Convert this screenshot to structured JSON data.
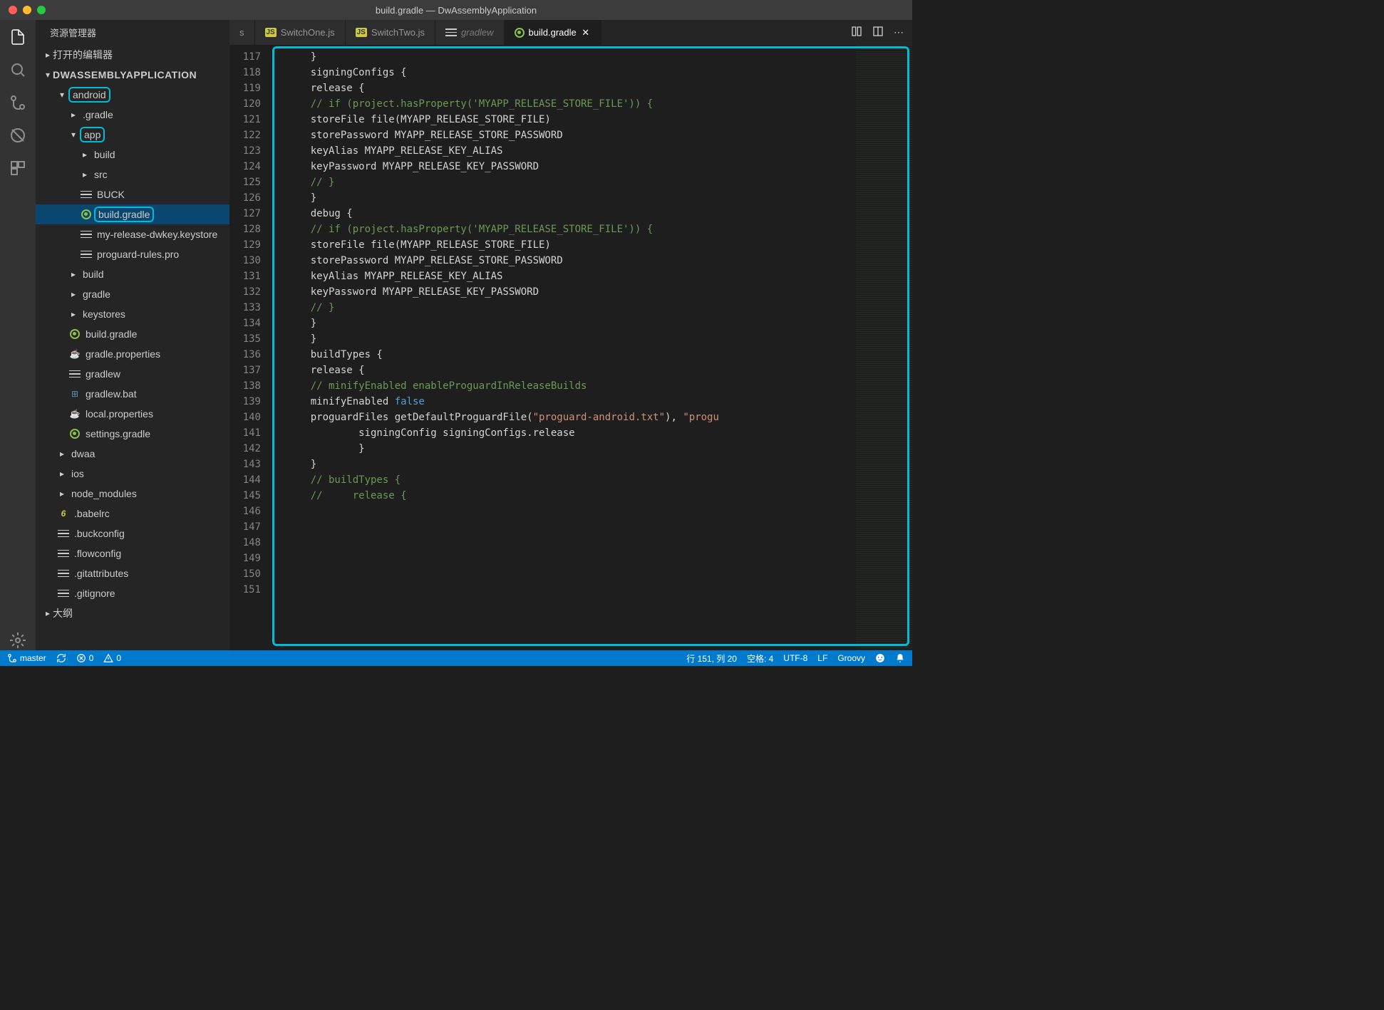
{
  "window": {
    "title": "build.gradle — DwAssemblyApplication"
  },
  "sidebar": {
    "title": "资源管理器",
    "sections": {
      "openEditors": "打开的编辑器",
      "project": "DWASSEMBLYAPPLICATION",
      "outline": "大纲"
    },
    "tree": [
      {
        "l": "android",
        "d": 1,
        "exp": true,
        "box": true
      },
      {
        "l": ".gradle",
        "d": 2,
        "kind": "folder"
      },
      {
        "l": "app",
        "d": 2,
        "exp": true,
        "box": true
      },
      {
        "l": "build",
        "d": 3,
        "kind": "folder"
      },
      {
        "l": "src",
        "d": 3,
        "kind": "folder"
      },
      {
        "l": "BUCK",
        "d": 3,
        "icon": "lines"
      },
      {
        "l": "build.gradle",
        "d": 3,
        "icon": "gradle",
        "sel": true,
        "box": true
      },
      {
        "l": "my-release-dwkey.keystore",
        "d": 3,
        "icon": "lines"
      },
      {
        "l": "proguard-rules.pro",
        "d": 3,
        "icon": "lines"
      },
      {
        "l": "build",
        "d": 2,
        "kind": "folder"
      },
      {
        "l": "gradle",
        "d": 2,
        "kind": "folder"
      },
      {
        "l": "keystores",
        "d": 2,
        "kind": "folder"
      },
      {
        "l": "build.gradle",
        "d": 2,
        "icon": "gradle"
      },
      {
        "l": "gradle.properties",
        "d": 2,
        "icon": "java"
      },
      {
        "l": "gradlew",
        "d": 2,
        "icon": "lines"
      },
      {
        "l": "gradlew.bat",
        "d": 2,
        "icon": "win"
      },
      {
        "l": "local.properties",
        "d": 2,
        "icon": "java"
      },
      {
        "l": "settings.gradle",
        "d": 2,
        "icon": "gradle"
      },
      {
        "l": "dwaa",
        "d": 1,
        "kind": "folder"
      },
      {
        "l": "ios",
        "d": 1,
        "kind": "folder"
      },
      {
        "l": "node_modules",
        "d": 1,
        "kind": "folder"
      },
      {
        "l": ".babelrc",
        "d": 1,
        "icon": "babel"
      },
      {
        "l": ".buckconfig",
        "d": 1,
        "icon": "lines"
      },
      {
        "l": ".flowconfig",
        "d": 1,
        "icon": "lines"
      },
      {
        "l": ".gitattributes",
        "d": 1,
        "icon": "lines"
      },
      {
        "l": ".gitignore",
        "d": 1,
        "icon": "lines"
      }
    ]
  },
  "tabs": [
    {
      "label": "s",
      "kind": "truncated"
    },
    {
      "label": "SwitchOne.js",
      "kind": "js"
    },
    {
      "label": "SwitchTwo.js",
      "kind": "js"
    },
    {
      "label": "gradlew",
      "kind": "italic"
    },
    {
      "label": "build.gradle",
      "kind": "gradle",
      "active": true
    }
  ],
  "code": {
    "start": 117,
    "lines": [
      {
        "t": "    }",
        "c": "id"
      },
      {
        "t": "    signingConfigs {",
        "c": "id"
      },
      {
        "t": "",
        "c": "id"
      },
      {
        "t": "    release {",
        "c": "id"
      },
      {
        "t": "    // if (project.hasProperty('MYAPP_RELEASE_STORE_FILE')) {",
        "c": "cm"
      },
      {
        "t": "    storeFile file(MYAPP_RELEASE_STORE_FILE)",
        "c": "id"
      },
      {
        "t": "    storePassword MYAPP_RELEASE_STORE_PASSWORD",
        "c": "id"
      },
      {
        "t": "    keyAlias MYAPP_RELEASE_KEY_ALIAS",
        "c": "id"
      },
      {
        "t": "    keyPassword MYAPP_RELEASE_KEY_PASSWORD",
        "c": "id"
      },
      {
        "t": "    // }",
        "c": "cm"
      },
      {
        "t": "    }",
        "c": "id"
      },
      {
        "t": "    debug {",
        "c": "id"
      },
      {
        "t": "    // if (project.hasProperty('MYAPP_RELEASE_STORE_FILE')) {",
        "c": "cm"
      },
      {
        "t": "    storeFile file(MYAPP_RELEASE_STORE_FILE)",
        "c": "id"
      },
      {
        "t": "    storePassword MYAPP_RELEASE_STORE_PASSWORD",
        "c": "id"
      },
      {
        "t": "    keyAlias MYAPP_RELEASE_KEY_ALIAS",
        "c": "id"
      },
      {
        "t": "    keyPassword MYAPP_RELEASE_KEY_PASSWORD",
        "c": "id"
      },
      {
        "t": "    // }",
        "c": "cm"
      },
      {
        "t": "    }",
        "c": "id"
      },
      {
        "t": "",
        "c": "id"
      },
      {
        "t": "",
        "c": "id"
      },
      {
        "t": "",
        "c": "id"
      },
      {
        "t": "",
        "c": "id"
      },
      {
        "t": "    }",
        "c": "id"
      },
      {
        "t": "",
        "c": "id"
      },
      {
        "t": "    buildTypes {",
        "c": "id"
      },
      {
        "t": "    release {",
        "c": "id"
      },
      {
        "t": "    // minifyEnabled enableProguardInReleaseBuilds",
        "c": "cm"
      },
      {
        "html": "    minifyEnabled <span class='kw'>false</span>"
      },
      {
        "html": "    proguardFiles getDefaultProguardFile(<span class='str'>\"proguard-android.txt\"</span>), <span class='str'>\"progu</span>"
      },
      {
        "t": "            signingConfig signingConfigs.release",
        "c": "id"
      },
      {
        "t": "            }",
        "c": "id"
      },
      {
        "t": "    }",
        "c": "id"
      },
      {
        "t": "    // buildTypes {",
        "c": "cm"
      },
      {
        "t": "    //     release {",
        "c": "cm"
      }
    ]
  },
  "status": {
    "branch": "master",
    "errors": "0",
    "warnings": "0",
    "line_col": "行 151, 列 20",
    "spaces": "空格: 4",
    "encoding": "UTF-8",
    "eol": "LF",
    "lang": "Groovy"
  }
}
